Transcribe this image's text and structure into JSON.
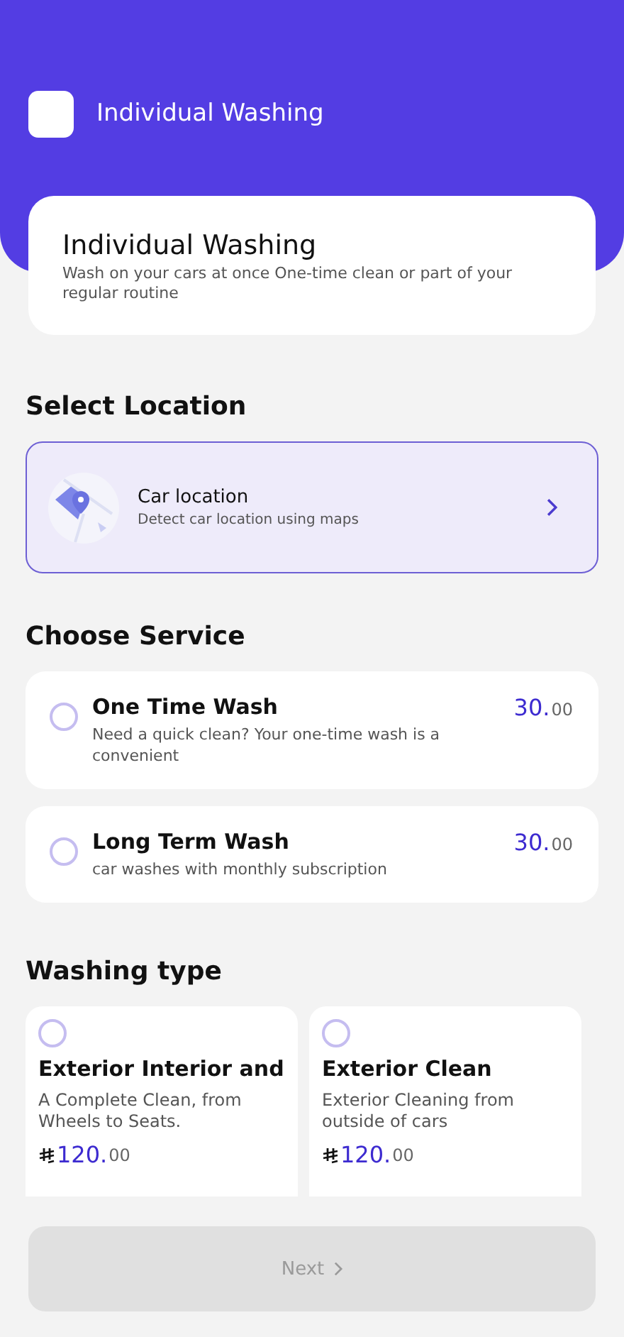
{
  "header": {
    "title": "Individual Washing"
  },
  "intro": {
    "title": "Individual Washing",
    "description": " Wash on your cars at once One-time clean or part of your regular routine"
  },
  "location_section": {
    "title": "Select Location",
    "card": {
      "title": "Car location",
      "subtitle": "Detect car location using maps"
    }
  },
  "service_section": {
    "title": "Choose Service",
    "services": [
      {
        "name": "One Time Wash",
        "description": "Need a quick clean? Your one-time wash is a convenient",
        "price": "30.",
        "cents": "00",
        "selected": false
      },
      {
        "name": "Long Term Wash",
        "description": "car washes with monthly subscription",
        "price": "30.",
        "cents": "00",
        "selected": false
      }
    ]
  },
  "washing_section": {
    "title": "Washing type",
    "types": [
      {
        "name": "Exterior Interior and",
        "description": "A Complete Clean, from Wheels to Seats.",
        "price": "120.",
        "cents": "00",
        "selected": false
      },
      {
        "name": "Exterior Clean",
        "description": "Exterior Cleaning from outside of cars",
        "price": "120.",
        "cents": "00",
        "selected": false
      }
    ]
  },
  "next_button": {
    "label": "Next",
    "disabled": true
  }
}
